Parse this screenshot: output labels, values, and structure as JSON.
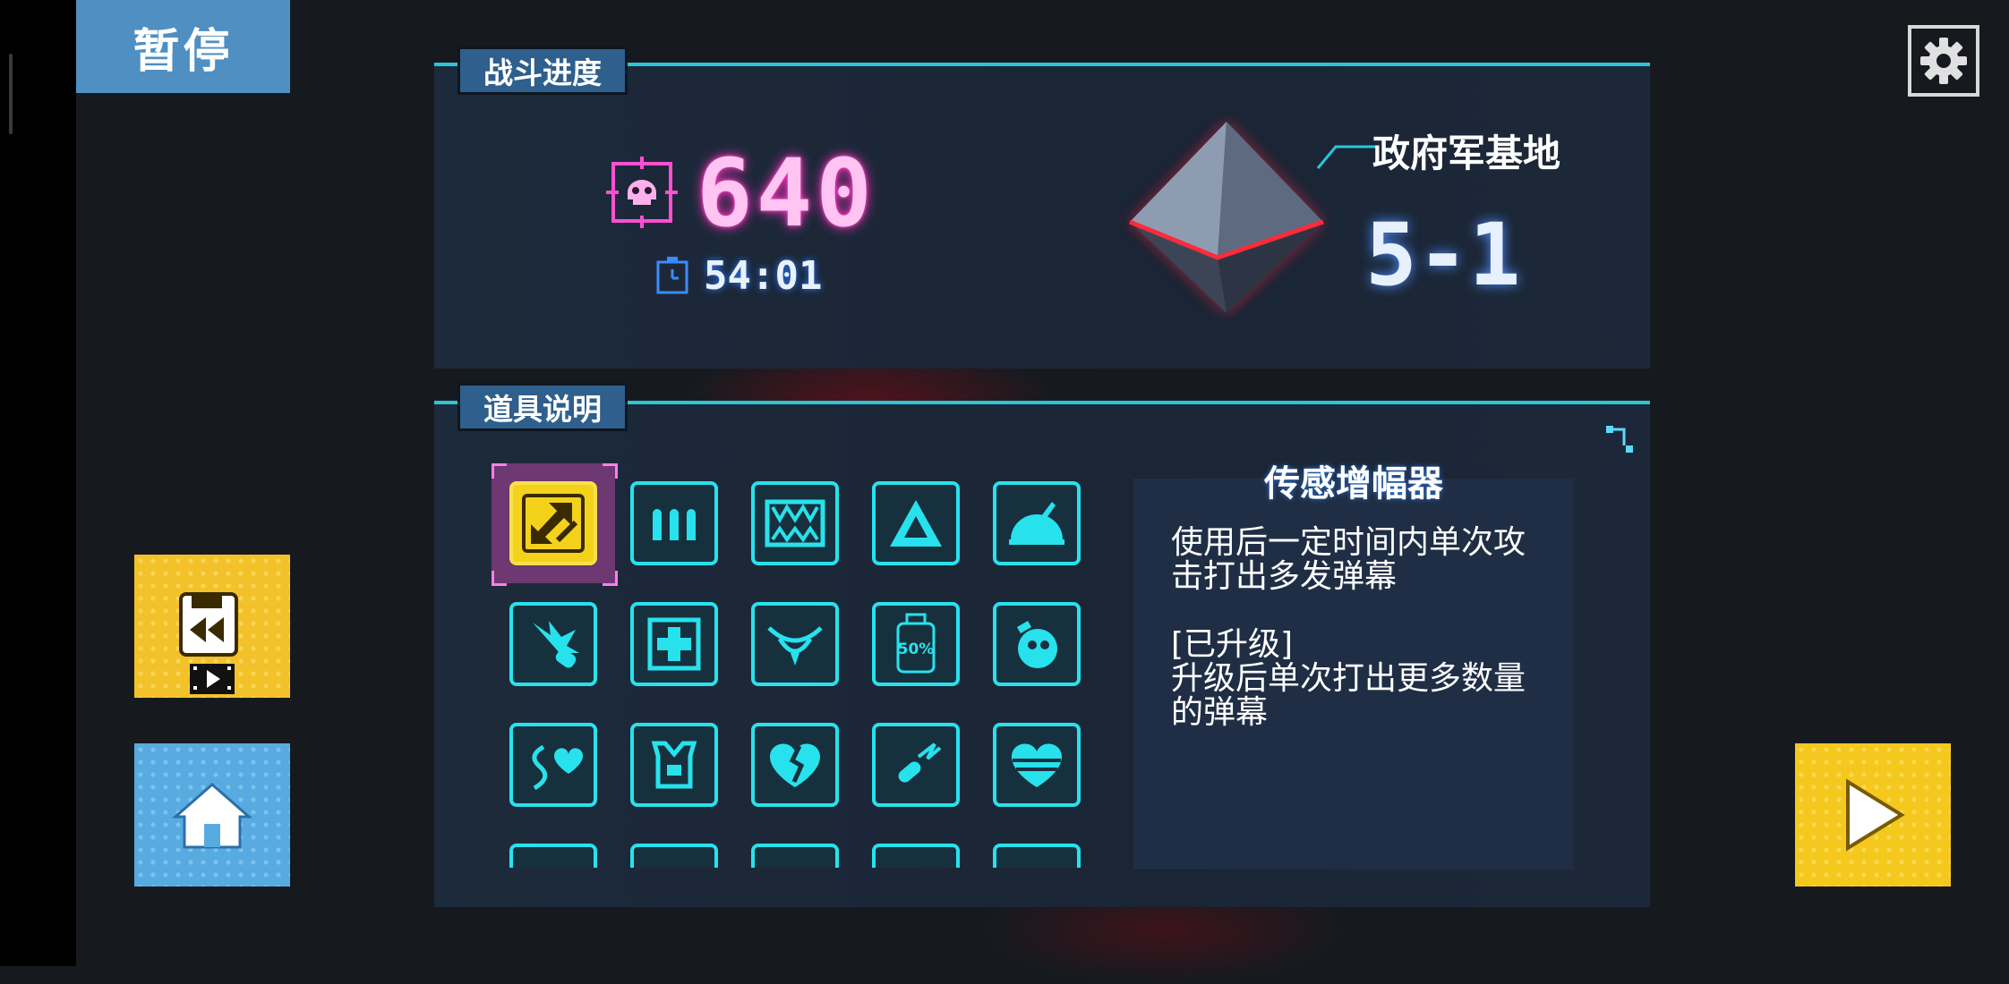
{
  "header": {
    "pause_label": "暂停"
  },
  "battle_progress": {
    "tab_label": "战斗进度",
    "kill_count": "640",
    "timer": "54:01",
    "stage_name": "政府军基地",
    "stage_number": "5-1"
  },
  "item_info": {
    "tab_label": "道具说明",
    "selected_title": "传感增幅器",
    "selected_description": "使用后一定时间内单次攻\n击打出多发弹幕\n\n[已升级]\n升级后单次打出更多数量\n的弹幕",
    "items": [
      {
        "icon": "sensor-amplifier-icon",
        "selected": true
      },
      {
        "icon": "ammo-icon"
      },
      {
        "icon": "fangs-icon"
      },
      {
        "icon": "triad-icon"
      },
      {
        "icon": "helmet-icon"
      },
      {
        "icon": "burst-icon"
      },
      {
        "icon": "medkit-icon"
      },
      {
        "icon": "eye-icon"
      },
      {
        "icon": "half-bottle-icon",
        "label": "50%"
      },
      {
        "icon": "potion-icon"
      },
      {
        "icon": "heart-hook-icon"
      },
      {
        "icon": "armor-vest-icon"
      },
      {
        "icon": "broken-heart-icon"
      },
      {
        "icon": "bullet-icon"
      },
      {
        "icon": "striped-heart-icon"
      }
    ]
  },
  "colors": {
    "accent_cyan": "#27e2ec",
    "kill_pink": "#ff2fbf",
    "selected_yellow": "#f4d21c",
    "tab_blue": "#2f5f8c"
  },
  "buttons": {
    "replay": "replay-video-icon",
    "home": "home-icon",
    "resume": "play-icon",
    "settings": "gear-icon"
  }
}
